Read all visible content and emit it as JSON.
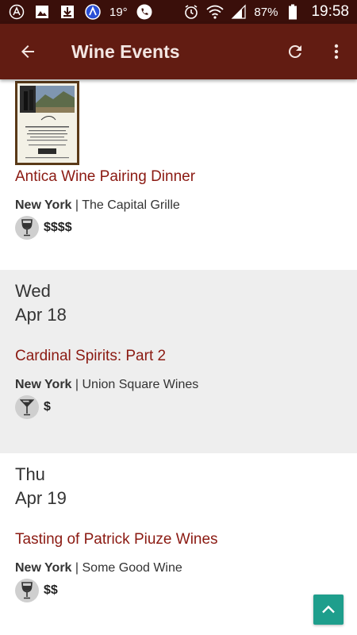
{
  "status_bar": {
    "temperature": "19°",
    "battery": "87%",
    "time": "19:58"
  },
  "app_bar": {
    "title": "Wine Events"
  },
  "events": [
    {
      "title": "Antica Wine Pairing Dinner",
      "city": "New York",
      "separator": "|",
      "venue": "The Capital Grille",
      "price": "$$$$",
      "type_icon": "wine-glass-icon"
    },
    {
      "day": "Wed",
      "date": "Apr 18",
      "title": "Cardinal Spirits: Part 2",
      "city": "New York",
      "separator": "|",
      "venue": "Union Square Wines",
      "price": "$",
      "type_icon": "cocktail-glass-icon"
    },
    {
      "day": "Thu",
      "date": "Apr 19",
      "title": "Tasting of Patrick Piuze Wines",
      "city": "New York",
      "separator": "|",
      "venue": "Some Good Wine",
      "price": "$$",
      "type_icon": "wine-glass-icon"
    }
  ],
  "colors": {
    "status_bar": "#3a0f0a",
    "app_bar": "#621c12",
    "event_title": "#8b1a12",
    "shaded_row": "#eeeeee",
    "fab": "#1e9e8c"
  }
}
